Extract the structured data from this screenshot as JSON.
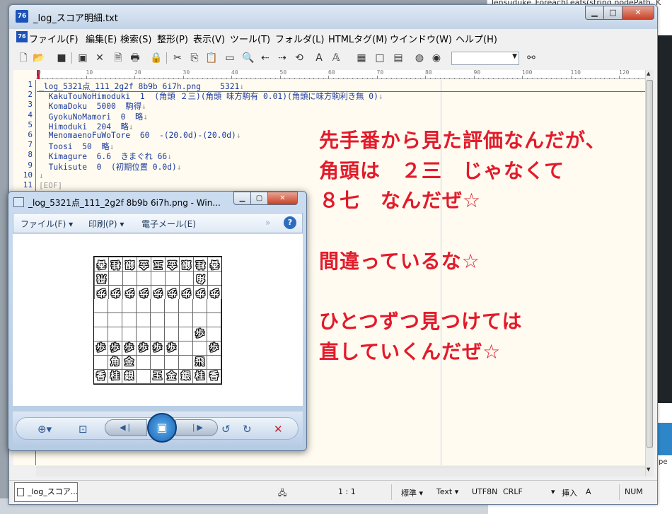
{
  "background": {
    "top_text": "Tensuduke_ForeachLeafs(string nodePath, K",
    "side_text": "pe"
  },
  "editor": {
    "title": "_log_スコア明細.txt",
    "app_icon_text": "76",
    "menu": [
      "ファイル(F)",
      "編集(E)",
      "検索(S)",
      "整形(P)",
      "表示(V)",
      "ツール(T)",
      "フォルダ(L)",
      "HTMLタグ(M)",
      "ウインドウ(W)",
      "ヘルプ(H)"
    ],
    "ruler": [
      "0",
      "10",
      "20",
      "30",
      "40",
      "50",
      "60",
      "70",
      "80",
      "90",
      "100",
      "110",
      "120"
    ],
    "line_numbers": [
      "1",
      "2",
      "3",
      "4",
      "5",
      "6",
      "7",
      "8",
      "9",
      "10",
      "11"
    ],
    "lines": [
      "_log_5321点_111_2g2f 8b9b 6i7h.png    5321",
      "  KakuTouNoHimoduki  1  (角頭 ２三)(角頭 味方駒有 0.01)(角頭に味方駒利き無 0)",
      "  KomaDoku  5000  駒得",
      "  GyokuNoMamori  0  略",
      "  Himoduki  204  略",
      "  MenomaenoFuWoTore  60  -(20.0d)-(20.0d)",
      "  Toosi  50  略",
      "  Kimagure  6.6  きまぐれ 66",
      "  Tukisute  0  (初期位置 0.0d)",
      "",
      ""
    ],
    "eol_mark": "↓",
    "eof": "[EOF]",
    "status": {
      "tab": "_log_スコア...",
      "position": "1 : 1",
      "mode": "標準",
      "type": "Text",
      "encoding": "UTF8N",
      "linebreak": "CRLF",
      "insert": "挿入",
      "a": "A",
      "num": "NUM"
    }
  },
  "overlay": {
    "lines": [
      "先手番から見た評価なんだが、",
      "角頭は　２三　じゃなくて",
      "８七　なんだぜ☆",
      "",
      "間違っているな☆",
      "",
      "ひとつずつ見つけては",
      "直していくんだぜ☆"
    ]
  },
  "viewer": {
    "title": "_log_5321点_111_2g2f 8b9b 6i7h.png - Win...",
    "commands": [
      "ファイル(F)",
      "印刷(P)",
      "電子メール(E)"
    ],
    "help": "?",
    "board": [
      [
        "香",
        "桂",
        "銀",
        "金",
        "玉",
        "金",
        "銀",
        "桂",
        "香"
      ],
      [
        "飛",
        "",
        "",
        "",
        "",
        "",
        "",
        "角",
        ""
      ],
      [
        "歩",
        "歩",
        "歩",
        "歩",
        "歩",
        "歩",
        "歩",
        "歩",
        "歩"
      ],
      [
        "",
        "",
        "",
        "",
        "",
        "",
        "",
        "",
        ""
      ],
      [
        "",
        "",
        "",
        "",
        "",
        "",
        "",
        "",
        ""
      ],
      [
        "",
        "",
        "",
        "",
        "",
        "",
        "",
        "歩",
        ""
      ],
      [
        "歩",
        "歩",
        "歩",
        "歩",
        "歩",
        "歩",
        "",
        "",
        "歩"
      ],
      [
        "",
        "角",
        "金",
        "",
        "",
        "",
        "",
        "飛",
        ""
      ],
      [
        "香",
        "桂",
        "銀",
        "",
        "玉",
        "金",
        "銀",
        "桂",
        "香"
      ]
    ],
    "board_reversed_rows": [
      0,
      1,
      2
    ]
  }
}
